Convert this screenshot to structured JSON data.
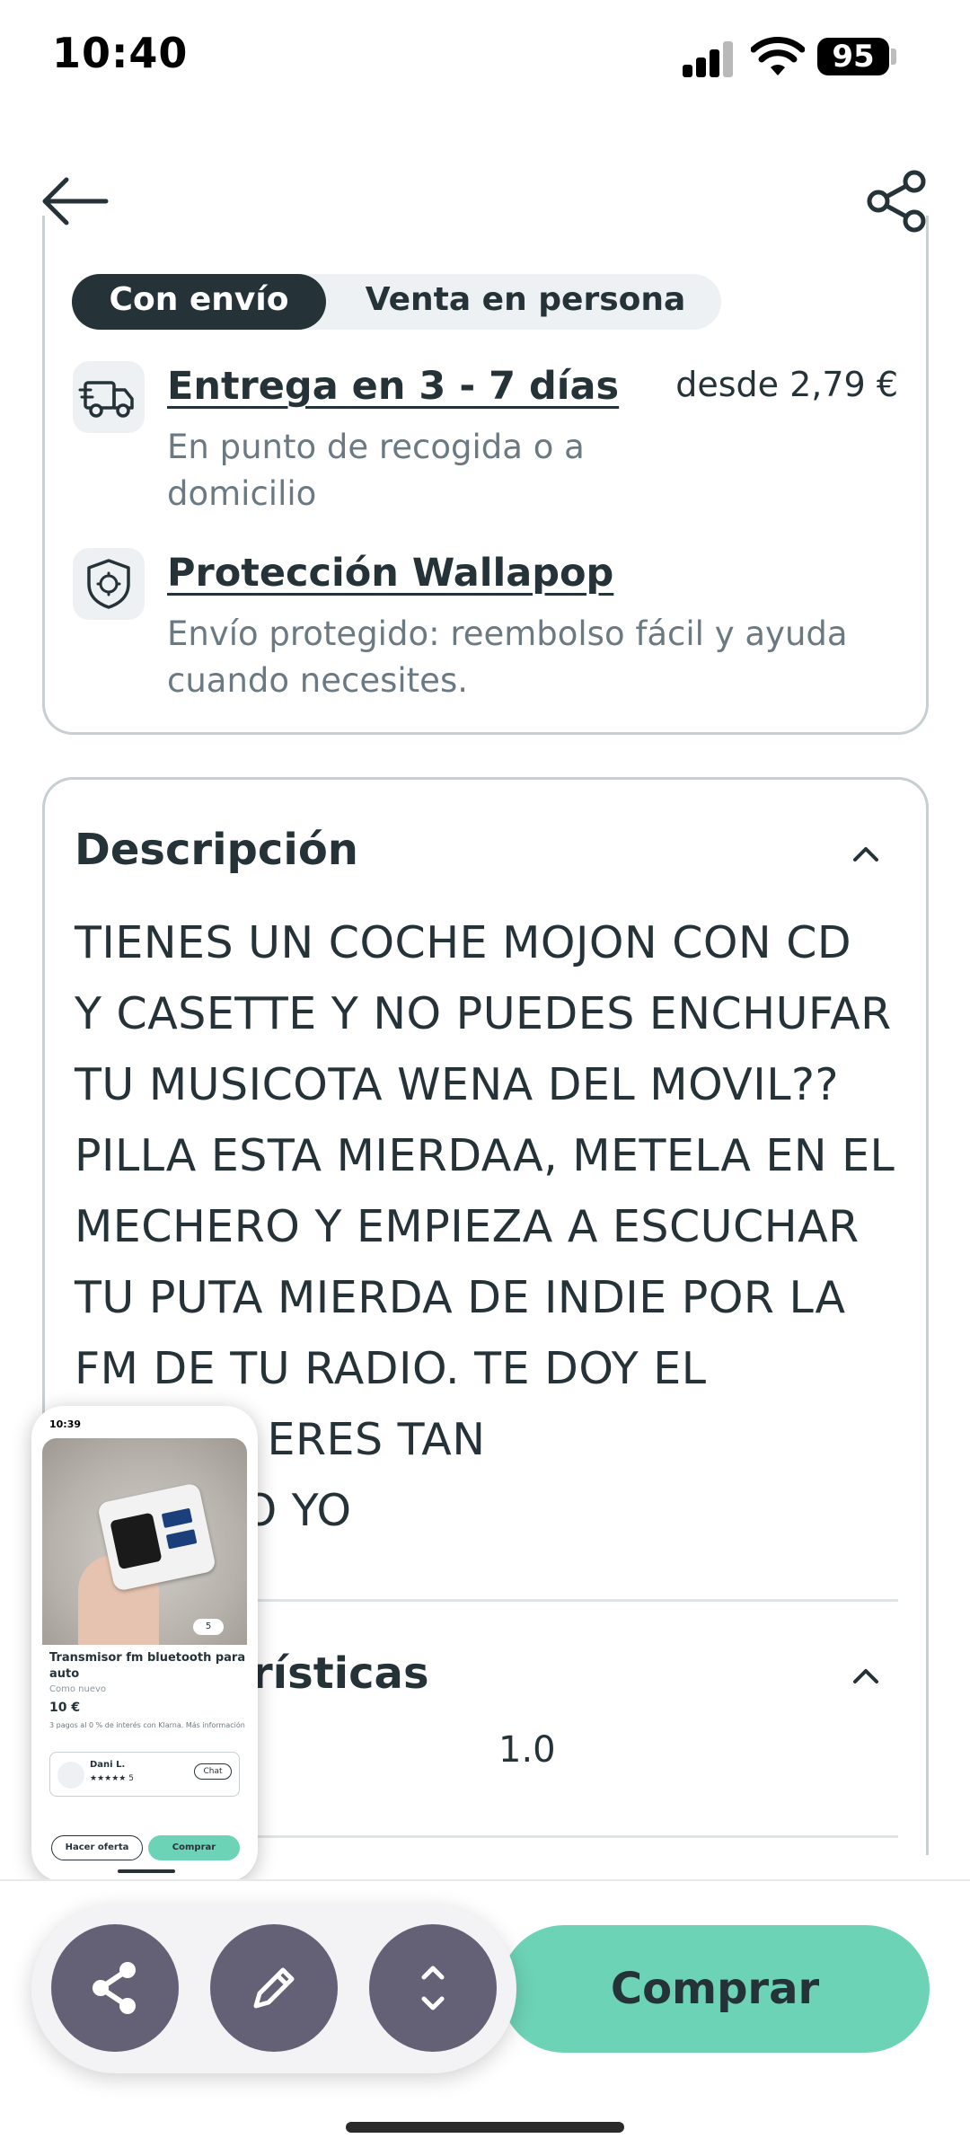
{
  "status_bar": {
    "time": "10:40",
    "battery": "95"
  },
  "shipping": {
    "tabs": {
      "active": "Con envío",
      "inactive": "Venta en persona"
    },
    "delivery": {
      "title": "Entrega en 3 - 7 días",
      "desc": "En punto de recogida o a domicilio",
      "price": "desde 2,79 €"
    },
    "protection": {
      "title": "Protección Wallapop",
      "desc": "Envío protegido: reembolso fácil y ayuda cuando necesites."
    }
  },
  "description": {
    "title": "Descripción",
    "text": "TIENES UN COCHE MOJON CON CD\nY CASETTE Y NO PUEDES ENCHUFAR\nTU MUSICOTA WENA DEL MOVIL??\nPILLA ESTA MIERDAA, METELA EN EL\nMECHERO Y EMPIEZA A ESCUCHAR\nTU PUTA MIERDA DE INDIE POR LA\nFM DE TU RADIO. TE DOY EL\n          . POR SI ERES TAN\n         IO COMO YO"
  },
  "characteristics": {
    "title_visible": "rísticas",
    "value": "1.0"
  },
  "preview": {
    "time": "10:39",
    "like_count": "5",
    "title": "Transmisor fm bluetooth para auto",
    "condition": "Como nuevo",
    "price": "10 €",
    "klarna": "3 pagos al 0 % de interés con Klarna. Más información",
    "seller": "Dani L.",
    "stars": "★★★★★ 5",
    "chat": "Chat",
    "offer": "Hacer oferta",
    "buy": "Comprar"
  },
  "bottom": {
    "buy_label": "Comprar"
  },
  "colors": {
    "primary": "#253238",
    "accent": "#6dd3b6",
    "tool_button": "#646177",
    "border": "#c7cfd3"
  },
  "icons": [
    "back-arrow-icon",
    "share-icon",
    "truck-icon",
    "shield-icon",
    "chevron-up-icon",
    "pencil-icon",
    "expand-icon"
  ]
}
